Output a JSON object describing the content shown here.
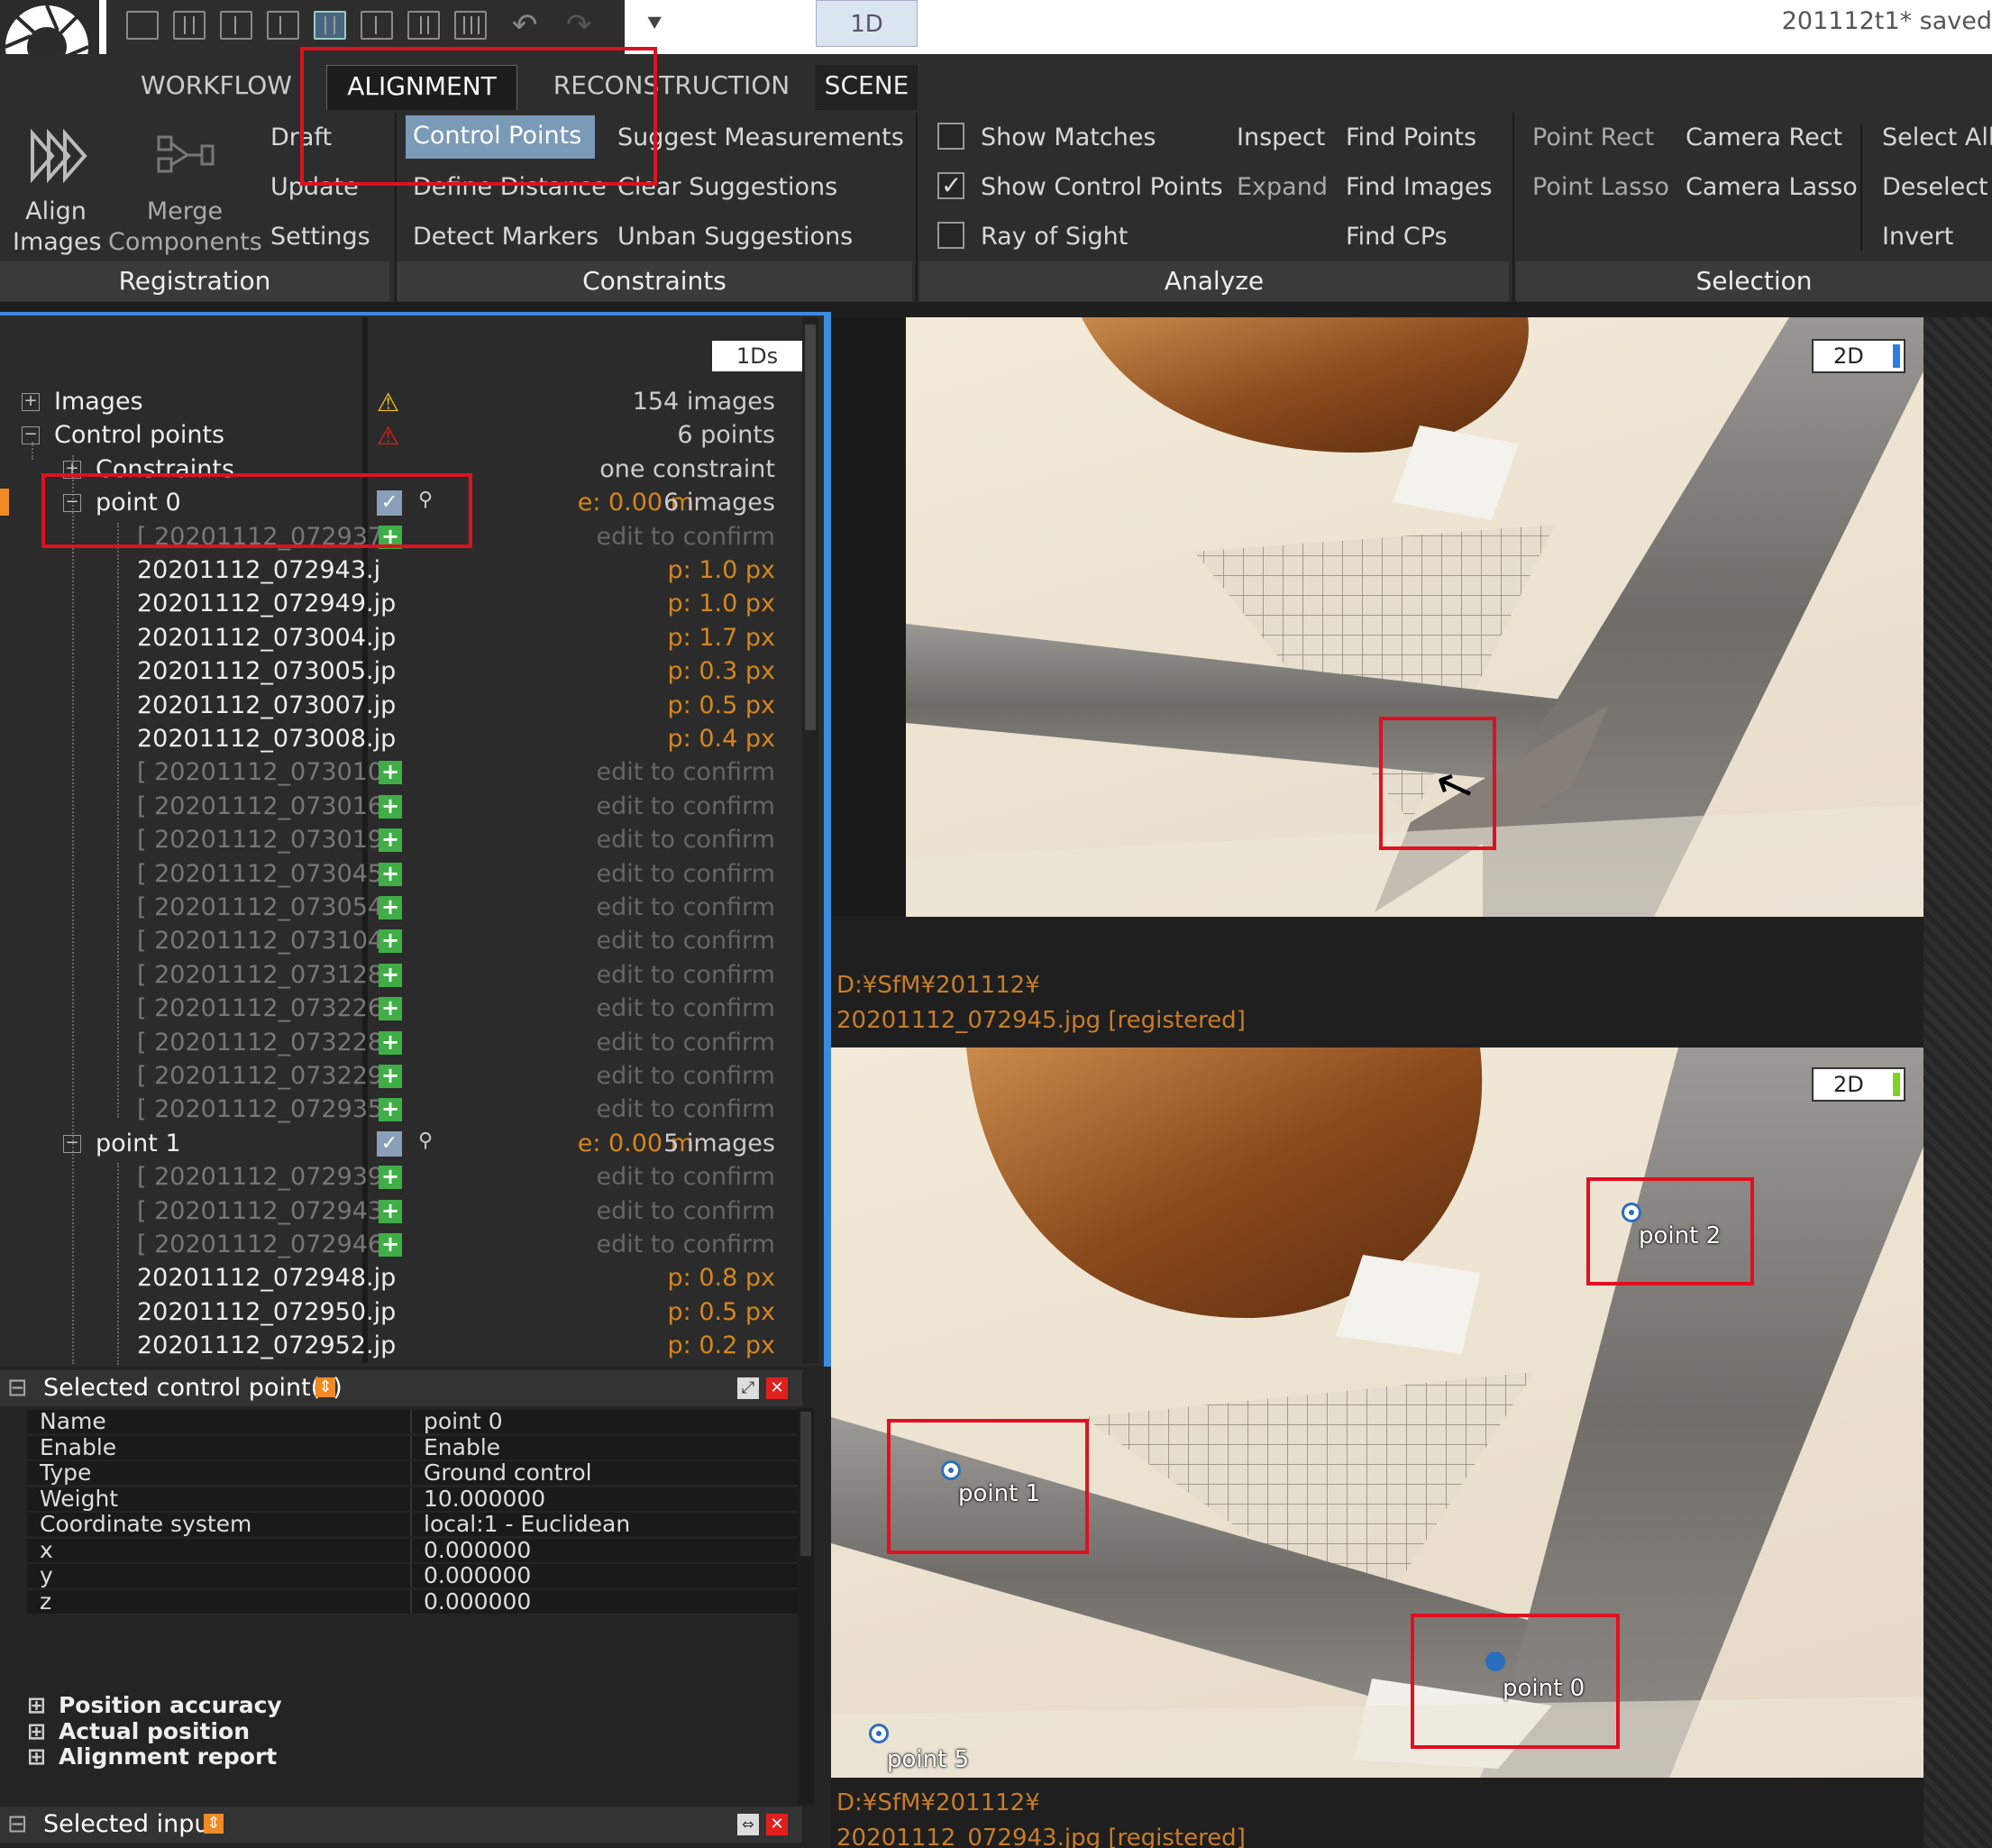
{
  "titlebar": {
    "tab_1d": "1D",
    "save_status": "201112t1* saved"
  },
  "tabs": [
    {
      "label": "WORKFLOW"
    },
    {
      "label": "ALIGNMENT"
    },
    {
      "label": "RECONSTRUCTION"
    },
    {
      "label": "SCENE"
    }
  ],
  "ribbon": {
    "registration": {
      "label": "Registration",
      "align_images": "Align Images",
      "merge_components": "Merge Components",
      "draft": "Draft",
      "update": "Update",
      "settings": "Settings"
    },
    "constraints": {
      "label": "Constraints",
      "control_points": "Control Points",
      "define_distance": "Define Distance",
      "detect_markers": "Detect Markers",
      "suggest_measurements": "Suggest Measurements",
      "clear_suggestions": "Clear Suggestions",
      "unban_suggestions": "Unban Suggestions"
    },
    "analyze": {
      "label": "Analyze",
      "show_matches": "Show Matches",
      "show_control_points": "Show Control Points",
      "ray_of_sight": "Ray of Sight",
      "inspect": "Inspect",
      "expand": "Expand",
      "find_points": "Find Points",
      "find_images": "Find Images",
      "find_cps": "Find CPs",
      "show_matches_checked": false,
      "show_control_points_checked": true,
      "ray_of_sight_checked": false
    },
    "selection": {
      "label": "Selection",
      "point_rect": "Point Rect",
      "point_lasso": "Point Lasso",
      "camera_rect": "Camera Rect",
      "camera_lasso": "Camera Lasso",
      "select_all": "Select All",
      "deselect": "Deselect",
      "invert": "Invert"
    }
  },
  "tree": {
    "button_1ds": "1Ds",
    "rows": [
      {
        "name": "Images",
        "value": "154 images"
      },
      {
        "name": "Control points",
        "value": "6 points"
      },
      {
        "name": "Constraints",
        "value": "one constraint"
      },
      {
        "name": "point 0",
        "value_e": "e: 0.00 m",
        "value": "6 images"
      },
      {
        "name": "[ 20201112_072937",
        "value": "edit to confirm"
      },
      {
        "name": "20201112_072943.j",
        "value": "p: 1.0 px"
      },
      {
        "name": "20201112_072949.jp",
        "value": "p: 1.0 px"
      },
      {
        "name": "20201112_073004.jp",
        "value": "p: 1.7 px"
      },
      {
        "name": "20201112_073005.jp",
        "value": "p: 0.3 px"
      },
      {
        "name": "20201112_073007.jp",
        "value": "p: 0.5 px"
      },
      {
        "name": "20201112_073008.jp",
        "value": "p: 0.4 px"
      },
      {
        "name": "[ 20201112_073010.",
        "value": "edit to confirm"
      },
      {
        "name": "[ 20201112_073016.",
        "value": "edit to confirm"
      },
      {
        "name": "[ 20201112_073019.",
        "value": "edit to confirm"
      },
      {
        "name": "[ 20201112_073045.",
        "value": "edit to confirm"
      },
      {
        "name": "[ 20201112_073054.",
        "value": "edit to confirm"
      },
      {
        "name": "[ 20201112_073104.",
        "value": "edit to confirm"
      },
      {
        "name": "[ 20201112_073128.",
        "value": "edit to confirm"
      },
      {
        "name": "[ 20201112_073226.",
        "value": "edit to confirm"
      },
      {
        "name": "[ 20201112_073228.",
        "value": "edit to confirm"
      },
      {
        "name": "[ 20201112_073229.",
        "value": "edit to confirm"
      },
      {
        "name": "[ 20201112_072935.",
        "value": "edit to confirm"
      },
      {
        "name": "point 1",
        "value_e": "e: 0.00 m",
        "value": "5 images"
      },
      {
        "name": "[ 20201112_072939.",
        "value": "edit to confirm"
      },
      {
        "name": "[ 20201112_072943",
        "value": "edit to confirm"
      },
      {
        "name": "[ 20201112_072946.",
        "value": "edit to confirm"
      },
      {
        "name": "20201112_072948.jp",
        "value": "p: 0.8 px"
      },
      {
        "name": "20201112_072950.jp",
        "value": "p: 0.5 px"
      },
      {
        "name": "20201112_072952.jp",
        "value": "p: 0.2 px"
      }
    ]
  },
  "properties": {
    "header": "Selected control point(s)",
    "rows": [
      {
        "key": "Name",
        "value": "point 0"
      },
      {
        "key": "Enable",
        "value": "Enable"
      },
      {
        "key": "Type",
        "value": "Ground control"
      },
      {
        "key": "Weight",
        "value": "10.000000"
      },
      {
        "key": "Coordinate system",
        "value": "local:1 - Euclidean"
      },
      {
        "key": "x",
        "value": "0.000000"
      },
      {
        "key": "y",
        "value": "0.000000"
      },
      {
        "key": "z",
        "value": "0.000000"
      }
    ],
    "sections": [
      "Position accuracy",
      "Actual position",
      "Alignment report"
    ],
    "selected_input": "Selected input"
  },
  "views": {
    "top": {
      "badge": "2D",
      "badge_color": "#2a7de1",
      "path_line1": "D:¥SfM¥201112¥",
      "path_line2": "20201112_072945.jpg [registered]"
    },
    "bottom": {
      "badge": "2D",
      "badge_color": "#7ed321",
      "path_line1": "D:¥SfM¥201112¥",
      "path_line2": "20201112_072943.jpg [registered]",
      "points": [
        {
          "label": "point 2"
        },
        {
          "label": "point 1"
        },
        {
          "label": "point 0"
        },
        {
          "label": "point 5"
        }
      ]
    }
  }
}
